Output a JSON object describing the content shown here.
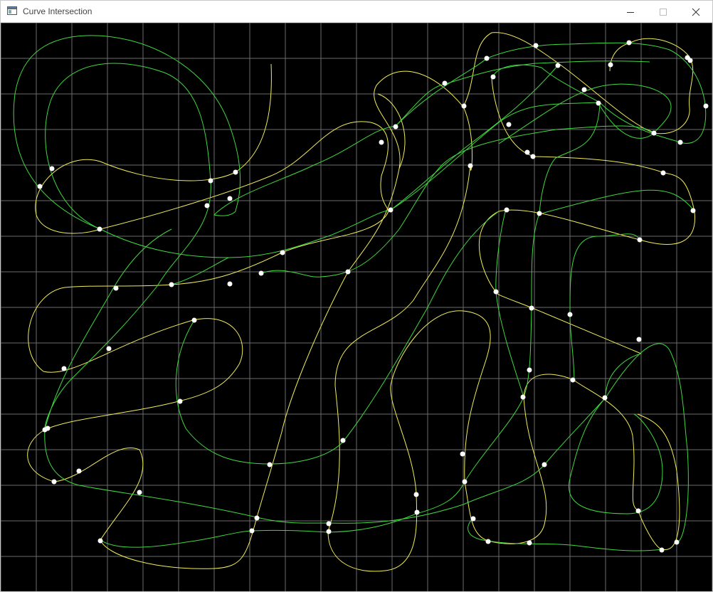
{
  "window": {
    "title": "Curve Intersection"
  },
  "titlebar_icons": {
    "app": "app-window-icon",
    "minimize": "minimize-icon",
    "maximize": "maximize-icon",
    "close": "close-icon"
  },
  "colors": {
    "background": "#000000",
    "grid": "#6b6b6b",
    "yellow_curve": "#f2ec5a",
    "green_curve": "#3fd83f",
    "intersection_marker": "#ffffff"
  },
  "canvas": {
    "grid": true
  }
}
